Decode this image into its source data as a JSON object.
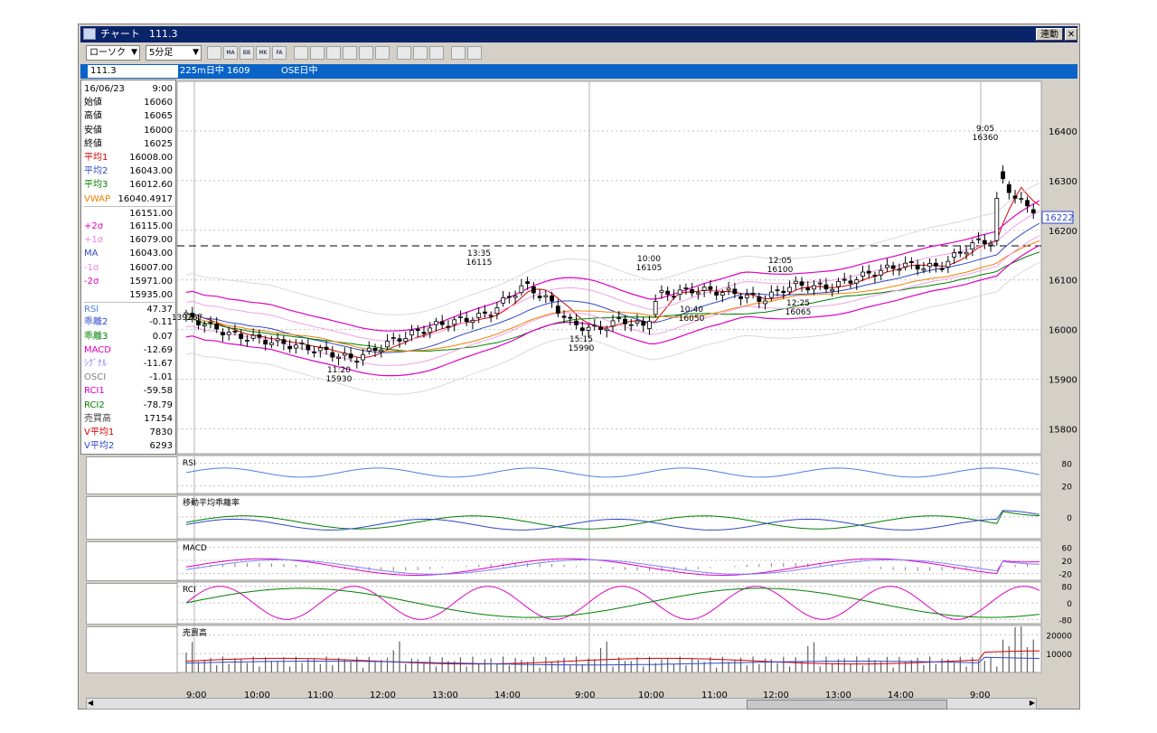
{
  "window": {
    "title": "チャート",
    "symbol": "111.3",
    "link_btn": "連動",
    "close_glyph": "✕"
  },
  "toolbar": {
    "chart_type": "ローソク",
    "interval": "5分足",
    "arrow": "▼",
    "icons": [
      "bar-chart-icon",
      "ma-icon",
      "bb-icon",
      "mk-icon",
      "fa-icon",
      "wave-icon",
      "period-icon",
      "cross-icon",
      "zoom-icon",
      "compare-icon",
      "grid-icon",
      "pen-icon",
      "pointer-icon",
      "eraser-icon",
      "lookup-icon",
      "draw-icon"
    ],
    "icon_texts": [
      "",
      "MA",
      "BB",
      "MK",
      "FA",
      "",
      "",
      "",
      "",
      "",
      "",
      "",
      "",
      "",
      "",
      ""
    ]
  },
  "infobar": {
    "symbol": "111.3",
    "index": "225m日中 1609",
    "market": "OSE日中"
  },
  "panel": {
    "rows": [
      {
        "label": "16/06/23",
        "value": "9:00",
        "color": "#000000"
      },
      {
        "label": "始値",
        "value": "16060",
        "color": "#000000"
      },
      {
        "label": "高値",
        "value": "16065",
        "color": "#000000"
      },
      {
        "label": "安値",
        "value": "16000",
        "color": "#000000"
      },
      {
        "label": "終値",
        "value": "16025",
        "color": "#000000"
      },
      {
        "label": "平均1",
        "value": "16008.00",
        "color": "#d40000"
      },
      {
        "label": "平均2",
        "value": "16043.00",
        "color": "#3048c8"
      },
      {
        "label": "平均3",
        "value": "16012.60",
        "color": "#008000"
      },
      {
        "label": "VWAP",
        "value": "16040.4917",
        "color": "#f08000"
      },
      {
        "label": "",
        "value": "16151.00",
        "color": "#000000"
      },
      {
        "label": "+2σ",
        "value": "16115.00",
        "color": "#e000c0"
      },
      {
        "label": "+1σ",
        "value": "16079.00",
        "color": "#f080e0"
      },
      {
        "label": "MA",
        "value": "16043.00",
        "color": "#3048c8"
      },
      {
        "label": "-1σ",
        "value": "16007.00",
        "color": "#f080e0"
      },
      {
        "label": "-2σ",
        "value": "15971.00",
        "color": "#e000c0"
      },
      {
        "label": "",
        "value": "15935.00",
        "color": "#000000"
      },
      {
        "label": "RSI",
        "value": "47.37",
        "color": "#4a80e0"
      },
      {
        "label": "乖離2",
        "value": "-0.11",
        "color": "#3048c8"
      },
      {
        "label": "乖離3",
        "value": "0.07",
        "color": "#008000"
      },
      {
        "label": "MACD",
        "value": "-12.69",
        "color": "#e000c0"
      },
      {
        "label": "ｼｸﾞﾅﾙ",
        "value": "-11.67",
        "color": "#8080ff"
      },
      {
        "label": "OSCI",
        "value": "-1.01",
        "color": "#808080"
      },
      {
        "label": "RCI1",
        "value": "-59.58",
        "color": "#e000c0"
      },
      {
        "label": "RCI2",
        "value": "-78.79",
        "color": "#008000"
      },
      {
        "label": "売買高",
        "value": "17154",
        "color": "#404040"
      },
      {
        "label": "V平均1",
        "value": "7830",
        "color": "#d40000"
      },
      {
        "label": "V平均2",
        "value": "6293",
        "color": "#3048c8"
      }
    ]
  },
  "chart_data": [
    {
      "type": "line",
      "title": "",
      "y_ticks": [
        "16400",
        "16300",
        "16200",
        "16100",
        "16000",
        "15900",
        "15800"
      ],
      "ylim": [
        15750,
        16500
      ],
      "current_price": "16222",
      "annotations": [
        {
          "time": "9:05",
          "price": "16360"
        },
        {
          "time": "13:35",
          "price": "16115"
        },
        {
          "time": "10:00",
          "price": "16105"
        },
        {
          "time": "12:05",
          "price": "16100"
        },
        {
          "time": "10:40",
          "price": "16050"
        },
        {
          "time": "12:25",
          "price": "16065"
        },
        {
          "time": "15:15",
          "price": "15990"
        },
        {
          "time": "11:20",
          "price": "15930"
        },
        {
          "time": "",
          "price": "139267"
        }
      ],
      "legend": "none"
    },
    {
      "type": "line",
      "title": "RSI",
      "y_ticks": [
        "80",
        "20"
      ]
    },
    {
      "type": "line",
      "title": "移動平均乖離率",
      "y_ticks": [
        "0"
      ]
    },
    {
      "type": "line",
      "title": "MACD",
      "y_ticks": [
        "60",
        "20",
        "-20"
      ]
    },
    {
      "type": "line",
      "title": "RCI",
      "y_ticks": [
        "80",
        "0",
        "-80"
      ]
    },
    {
      "type": "bar",
      "title": "売買高",
      "y_ticks": [
        "20000",
        "10000"
      ]
    }
  ],
  "xaxis": {
    "labels": [
      "9:00",
      "10:00",
      "11:00",
      "12:00",
      "13:00",
      "14:00",
      "9:00",
      "10:00",
      "11:00",
      "12:00",
      "13:00",
      "14:00",
      "9:00"
    ]
  }
}
